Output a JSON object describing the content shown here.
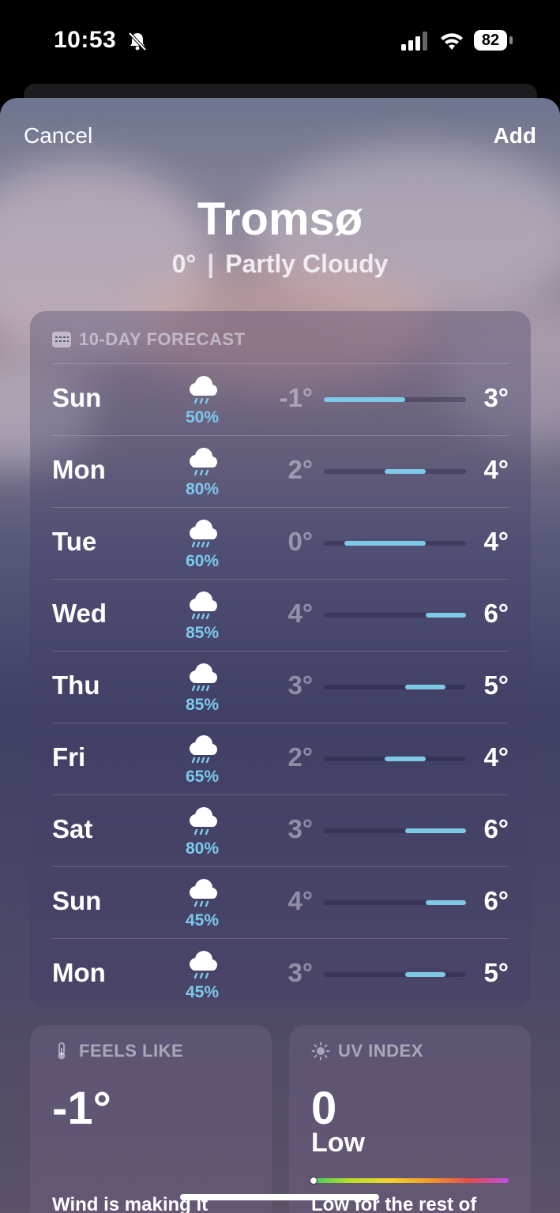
{
  "status": {
    "time": "10:53",
    "battery": "82"
  },
  "nav": {
    "cancel": "Cancel",
    "add": "Add"
  },
  "location": {
    "city": "Tromsø",
    "temp": "0°",
    "separator": "|",
    "condition": "Partly Cloudy"
  },
  "forecast": {
    "header": "10-DAY FORECAST",
    "range": [
      -1,
      6
    ],
    "days": [
      {
        "day": "Sun",
        "precip": "50%",
        "low": "-1°",
        "high": "3°",
        "low_val": -1,
        "high_val": 3
      },
      {
        "day": "Mon",
        "precip": "80%",
        "low": "2°",
        "high": "4°",
        "low_val": 2,
        "high_val": 4
      },
      {
        "day": "Tue",
        "precip": "60%",
        "low": "0°",
        "high": "4°",
        "low_val": 0,
        "high_val": 4
      },
      {
        "day": "Wed",
        "precip": "85%",
        "low": "4°",
        "high": "6°",
        "low_val": 4,
        "high_val": 6
      },
      {
        "day": "Thu",
        "precip": "85%",
        "low": "3°",
        "high": "5°",
        "low_val": 3,
        "high_val": 5
      },
      {
        "day": "Fri",
        "precip": "65%",
        "low": "2°",
        "high": "4°",
        "low_val": 2,
        "high_val": 4
      },
      {
        "day": "Sat",
        "precip": "80%",
        "low": "3°",
        "high": "6°",
        "low_val": 3,
        "high_val": 6
      },
      {
        "day": "Sun",
        "precip": "45%",
        "low": "4°",
        "high": "6°",
        "low_val": 4,
        "high_val": 6
      },
      {
        "day": "Mon",
        "precip": "45%",
        "low": "3°",
        "high": "5°",
        "low_val": 3,
        "high_val": 5
      }
    ]
  },
  "feels_like": {
    "header": "FEELS LIKE",
    "value": "-1°",
    "note": "Wind is making it"
  },
  "uv": {
    "header": "UV INDEX",
    "value": "0",
    "level": "Low",
    "index_val": 0,
    "note": "Low for the rest of"
  },
  "colors": {
    "precip": "#7ccaf0",
    "bar_fill": "#7fc9e8"
  }
}
